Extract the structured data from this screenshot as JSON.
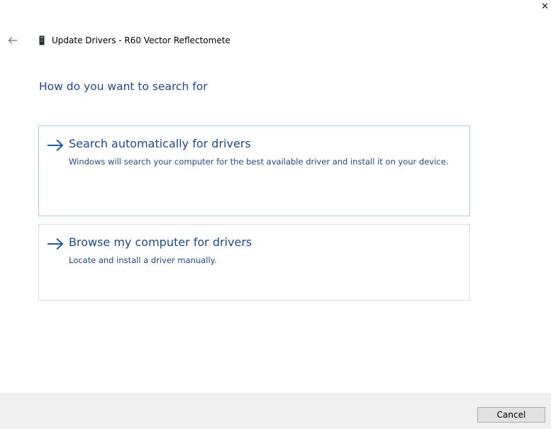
{
  "window": {
    "title": "Update Drivers - R60 Vector Reflectomete",
    "close_glyph": "✕",
    "back_icon": "back-arrow-icon",
    "device_icon": "device-icon"
  },
  "main": {
    "question": "How do you want to search for",
    "options": [
      {
        "title": "Search automatically for drivers",
        "description": "Windows will search your computer for the best available driver and install it on your device.",
        "icon": "arrow-right-icon"
      },
      {
        "title": "Browse my computer for drivers",
        "description": "Locate and install a driver manually.",
        "icon": "arrow-right-icon"
      }
    ]
  },
  "footer": {
    "cancel_label": "Cancel"
  },
  "colors": {
    "link_blue": "#1a4a96",
    "arrow_blue": "#1a5fb4",
    "option_border_hover": "#a9cfee",
    "option_border": "#dcdcdc",
    "footer_bg": "#f0f0f0",
    "button_bg": "#e1e1e1"
  }
}
